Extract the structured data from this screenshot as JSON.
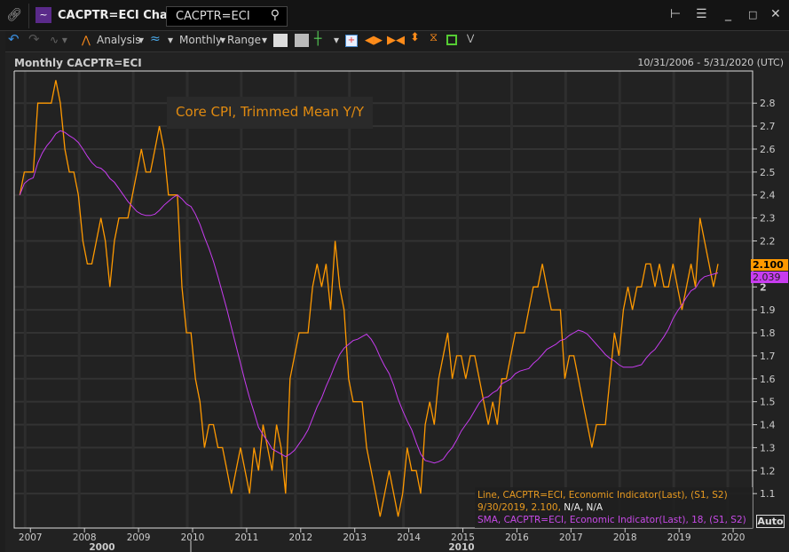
{
  "window": {
    "title": "CACPTR=ECI Chart",
    "ric_input": "CACPTR=ECI",
    "icons": [
      "link-icon",
      "chart-app-icon",
      "search-icon",
      "tree-icon",
      "menu-icon",
      "minimize-icon",
      "maximize-icon",
      "close-icon"
    ]
  },
  "toolbar": {
    "analysis": "Analysis",
    "interval": "Monthly",
    "range": "Range"
  },
  "chart": {
    "title": "Monthly CACPTR=ECI",
    "date_range": "10/31/2006 - 5/31/2020 (UTC)",
    "annotation": "Core CPI, Trimmed Mean Y/Y",
    "last_value_tag": "2.100",
    "sma_value_tag": "2.039",
    "auto_label": "Auto",
    "legend": {
      "line1": "Line, CACPTR=ECI, Economic Indicator(Last), (S1, S2)",
      "line2_a": "9/30/2019, 2.100, ",
      "line2_b": "N/A, N/A",
      "line3": "SMA, CACPTR=ECI, Economic Indicator(Last),  18, (S1, S2)"
    },
    "colors": {
      "line": "#ff9900",
      "sma": "#c83cf0"
    }
  },
  "chart_data": {
    "type": "line",
    "title": "Core CPI, Trimmed Mean Y/Y",
    "x_start": "2006-10",
    "frequency": "monthly",
    "series": [
      {
        "name": "CACPTR=ECI",
        "values": [
          2.4,
          2.5,
          2.5,
          2.5,
          2.8,
          2.8,
          2.8,
          2.8,
          2.9,
          2.8,
          2.6,
          2.5,
          2.5,
          2.4,
          2.2,
          2.1,
          2.1,
          2.2,
          2.3,
          2.2,
          2.0,
          2.2,
          2.3,
          2.3,
          2.3,
          2.4,
          2.5,
          2.6,
          2.5,
          2.5,
          2.6,
          2.7,
          2.6,
          2.4,
          2.4,
          2.4,
          2.0,
          1.8,
          1.8,
          1.6,
          1.5,
          1.3,
          1.4,
          1.4,
          1.3,
          1.3,
          1.2,
          1.1,
          1.2,
          1.3,
          1.2,
          1.1,
          1.3,
          1.2,
          1.4,
          1.3,
          1.2,
          1.4,
          1.3,
          1.1,
          1.6,
          1.7,
          1.8,
          1.8,
          1.8,
          2.0,
          2.1,
          2.0,
          2.1,
          1.9,
          2.2,
          2.0,
          1.9,
          1.6,
          1.5,
          1.5,
          1.5,
          1.3,
          1.2,
          1.1,
          1.0,
          1.1,
          1.2,
          1.1,
          1.0,
          1.1,
          1.3,
          1.2,
          1.2,
          1.1,
          1.4,
          1.5,
          1.4,
          1.6,
          1.7,
          1.8,
          1.6,
          1.7,
          1.7,
          1.6,
          1.7,
          1.7,
          1.6,
          1.5,
          1.4,
          1.5,
          1.4,
          1.6,
          1.6,
          1.7,
          1.8,
          1.8,
          1.8,
          1.9,
          2.0,
          2.0,
          2.1,
          2.0,
          1.9,
          1.9,
          1.9,
          1.6,
          1.7,
          1.7,
          1.6,
          1.5,
          1.4,
          1.3,
          1.4,
          1.4,
          1.4,
          1.6,
          1.8,
          1.7,
          1.9,
          2.0,
          1.9,
          2.0,
          2.0,
          2.1,
          2.1,
          2.0,
          2.1,
          2.0,
          2.0,
          2.1,
          2.0,
          1.9,
          2.0,
          2.1,
          2.0,
          2.3,
          2.2,
          2.1,
          2.0,
          2.1
        ]
      },
      {
        "name": "SMA 18",
        "window": 18
      }
    ],
    "x_ticks": [
      "2007",
      "2008",
      "2009",
      "2010",
      "2011",
      "2012",
      "2013",
      "2014",
      "2015",
      "2016",
      "2017",
      "2018",
      "2019",
      "2020"
    ],
    "decade_labels": [
      "2000",
      "2010"
    ],
    "y_ticks": [
      "2.8",
      "2.7",
      "2.6",
      "2.5",
      "2.4",
      "2.3",
      "2.2",
      "2",
      "1.9",
      "1.8",
      "1.7",
      "1.6",
      "1.5",
      "1.4",
      "1.3",
      "1.2",
      "1.1"
    ],
    "ylim": [
      0.95,
      2.94
    ],
    "xlim": [
      2006.7,
      2020.36
    ],
    "grid": true
  }
}
